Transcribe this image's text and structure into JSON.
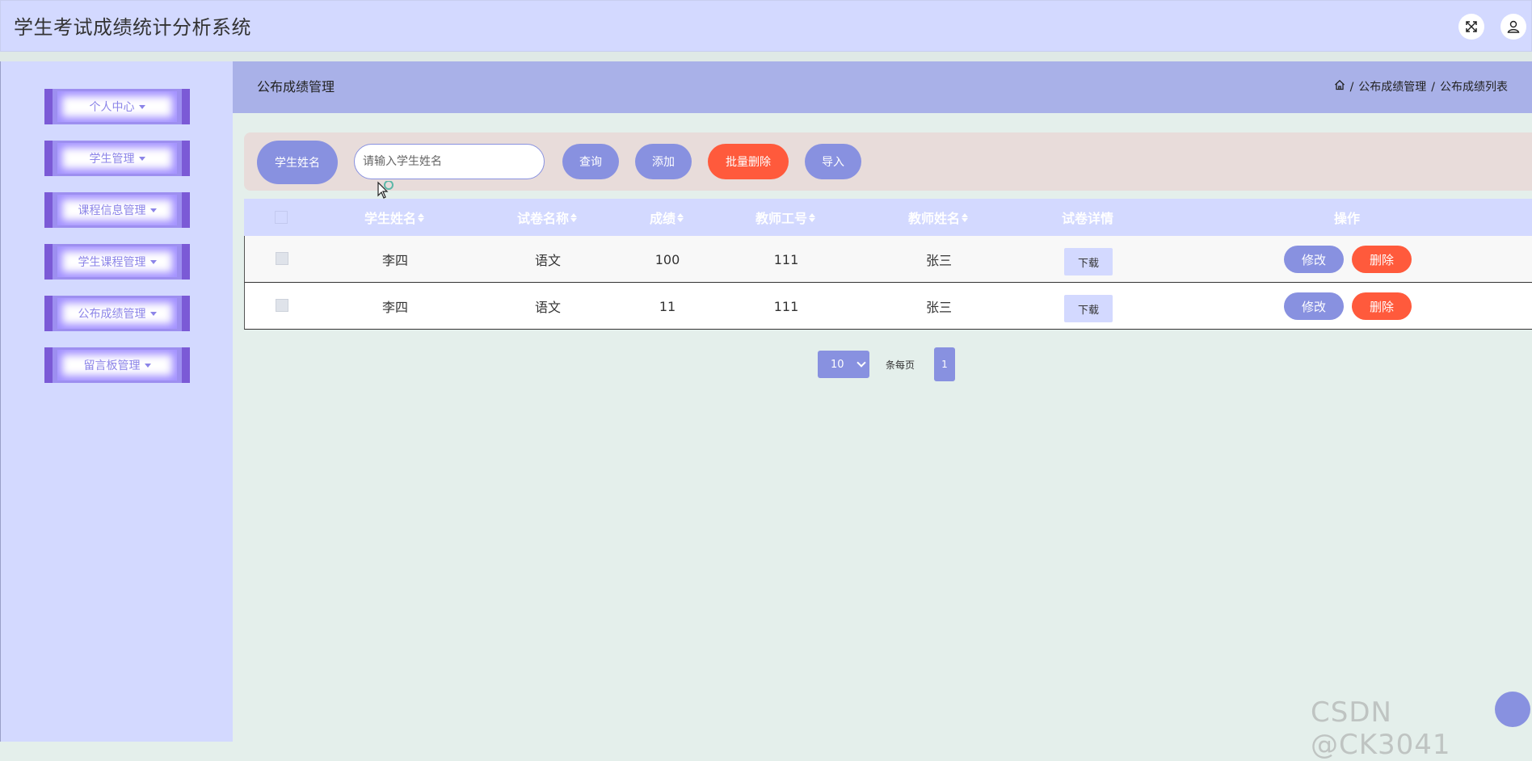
{
  "header": {
    "title": "学生考试成绩统计分析系统",
    "icons": [
      "fullscreen-icon",
      "user-icon"
    ]
  },
  "sidebar": {
    "items": [
      {
        "label": "个人中心"
      },
      {
        "label": "学生管理"
      },
      {
        "label": "课程信息管理"
      },
      {
        "label": "学生课程管理"
      },
      {
        "label": "公布成绩管理"
      },
      {
        "label": "留言板管理"
      }
    ]
  },
  "breadbar": {
    "heading": "公布成绩管理",
    "crumbs": [
      "公布成绩管理",
      "公布成绩列表"
    ],
    "separator": "/"
  },
  "search": {
    "label": "学生姓名",
    "placeholder": "请输入学生姓名",
    "value": "",
    "buttons": {
      "query": "查询",
      "add": "添加",
      "batch_delete": "批量删除",
      "import": "导入"
    }
  },
  "table": {
    "columns": [
      "学生姓名",
      "试卷名称",
      "成绩",
      "教师工号",
      "教师姓名",
      "试卷详情",
      "操作"
    ],
    "rows": [
      {
        "student": "李四",
        "paper": "语文",
        "score": "100",
        "teacher_id": "111",
        "teacher": "张三",
        "detail": "下载",
        "edit": "修改",
        "delete": "删除"
      },
      {
        "student": "李四",
        "paper": "语文",
        "score": "11",
        "teacher_id": "111",
        "teacher": "张三",
        "detail": "下载",
        "edit": "修改",
        "delete": "删除"
      }
    ]
  },
  "pagination": {
    "page_size": "10",
    "per_page_label": "条每页",
    "current_page": "1"
  },
  "watermark": "CSDN @CK3041",
  "colors": {
    "header_bg": "#d3d9ff",
    "accent": "#8891e0",
    "danger": "#ff5a3c",
    "menu_border": "#7b5ad6"
  }
}
